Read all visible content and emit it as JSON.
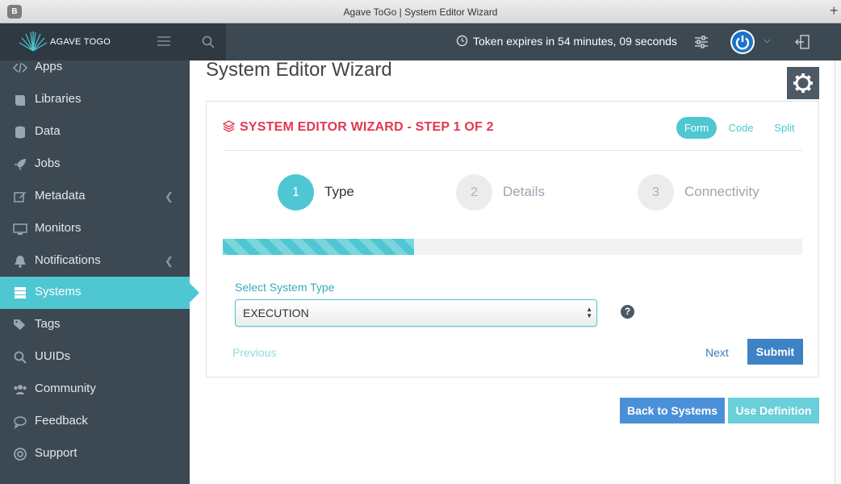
{
  "browser": {
    "favicon_letter": "B",
    "window_title": "Agave ToGo | System Editor Wizard",
    "new_tab": "+"
  },
  "topbar": {
    "brand": "AGAVE TOGO",
    "token_text": "Token expires in 54 minutes, 09 seconds",
    "icons": [
      "menu-icon",
      "search-icon",
      "clock-icon",
      "sliders-icon",
      "power-avatar-icon",
      "chevron-down-icon",
      "logout-icon"
    ]
  },
  "sidebar": {
    "items": [
      {
        "label": "Apps",
        "icon": "code-icon",
        "submenu": false,
        "active": false
      },
      {
        "label": "Libraries",
        "icon": "book-icon",
        "submenu": false,
        "active": false
      },
      {
        "label": "Data",
        "icon": "database-icon",
        "submenu": false,
        "active": false
      },
      {
        "label": "Jobs",
        "icon": "rocket-icon",
        "submenu": false,
        "active": false
      },
      {
        "label": "Metadata",
        "icon": "edit-icon",
        "submenu": true,
        "active": false
      },
      {
        "label": "Monitors",
        "icon": "monitor-icon",
        "submenu": false,
        "active": false
      },
      {
        "label": "Notifications",
        "icon": "bell-icon",
        "submenu": true,
        "active": false
      },
      {
        "label": "Systems",
        "icon": "server-icon",
        "submenu": false,
        "active": true
      },
      {
        "label": "Tags",
        "icon": "tags-icon",
        "submenu": false,
        "active": false
      },
      {
        "label": "UUIDs",
        "icon": "search-icon",
        "submenu": false,
        "active": false
      },
      {
        "label": "Community",
        "icon": "users-icon",
        "submenu": false,
        "active": false
      },
      {
        "label": "Feedback",
        "icon": "comment-icon",
        "submenu": false,
        "active": false
      },
      {
        "label": "Support",
        "icon": "lifebuoy-icon",
        "submenu": false,
        "active": false
      }
    ]
  },
  "main": {
    "page_title": "System Editor Wizard",
    "wizard": {
      "title": "SYSTEM EDITOR WIZARD - STEP 1 OF 2",
      "view_tabs": [
        {
          "label": "Form",
          "active": true
        },
        {
          "label": "Code",
          "active": false
        },
        {
          "label": "Split",
          "active": false
        }
      ],
      "steps": [
        {
          "number": "1",
          "label": "Type",
          "current": true
        },
        {
          "number": "2",
          "label": "Details",
          "current": false
        },
        {
          "number": "3",
          "label": "Connectivity",
          "current": false
        }
      ],
      "progress_fraction": 0.33,
      "field_label": "Select System Type",
      "field_value": "EXECUTION",
      "help": "?",
      "previous_label": "Previous",
      "next_label": "Next",
      "submit_label": "Submit"
    },
    "back_button": "Back to Systems",
    "use_button": "Use Definition"
  },
  "colors": {
    "accent": "#4fc7d2",
    "nav_bg": "#3c4852",
    "wizard_title": "#e1384f",
    "primary": "#3d82c4"
  }
}
